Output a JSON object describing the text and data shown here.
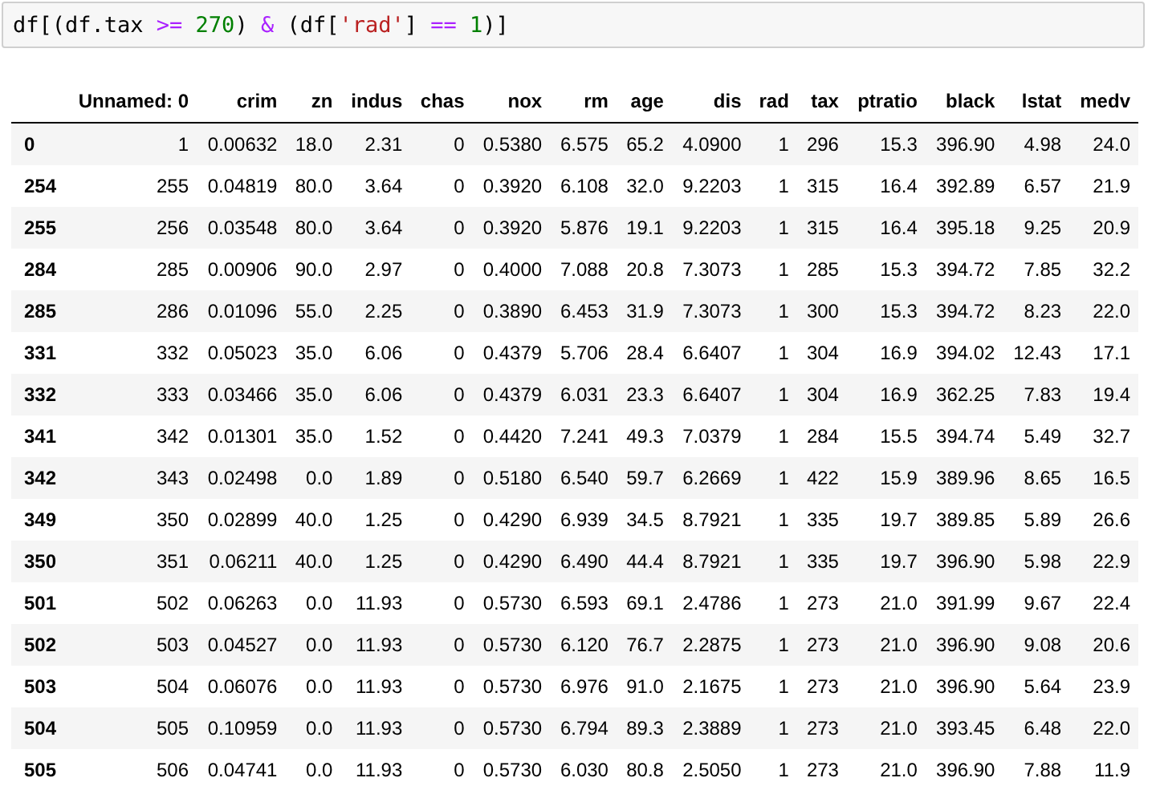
{
  "code_cell": {
    "tokens": [
      {
        "text": "df[(df.tax ",
        "kind": "plain"
      },
      {
        "text": ">=",
        "kind": "op"
      },
      {
        "text": " 270",
        "kind": "num"
      },
      {
        "text": ") ",
        "kind": "plain"
      },
      {
        "text": "&",
        "kind": "op"
      },
      {
        "text": " (df[",
        "kind": "plain"
      },
      {
        "text": "'rad'",
        "kind": "str"
      },
      {
        "text": "] ",
        "kind": "plain"
      },
      {
        "text": "==",
        "kind": "op"
      },
      {
        "text": " 1",
        "kind": "num"
      },
      {
        "text": ")]",
        "kind": "plain"
      }
    ]
  },
  "table": {
    "columns": [
      "Unnamed: 0",
      "crim",
      "zn",
      "indus",
      "chas",
      "nox",
      "rm",
      "age",
      "dis",
      "rad",
      "tax",
      "ptratio",
      "black",
      "lstat",
      "medv"
    ],
    "rows": [
      {
        "index": "0",
        "cells": [
          "1",
          "0.00632",
          "18.0",
          "2.31",
          "0",
          "0.5380",
          "6.575",
          "65.2",
          "4.0900",
          "1",
          "296",
          "15.3",
          "396.90",
          "4.98",
          "24.0"
        ]
      },
      {
        "index": "254",
        "cells": [
          "255",
          "0.04819",
          "80.0",
          "3.64",
          "0",
          "0.3920",
          "6.108",
          "32.0",
          "9.2203",
          "1",
          "315",
          "16.4",
          "392.89",
          "6.57",
          "21.9"
        ]
      },
      {
        "index": "255",
        "cells": [
          "256",
          "0.03548",
          "80.0",
          "3.64",
          "0",
          "0.3920",
          "5.876",
          "19.1",
          "9.2203",
          "1",
          "315",
          "16.4",
          "395.18",
          "9.25",
          "20.9"
        ]
      },
      {
        "index": "284",
        "cells": [
          "285",
          "0.00906",
          "90.0",
          "2.97",
          "0",
          "0.4000",
          "7.088",
          "20.8",
          "7.3073",
          "1",
          "285",
          "15.3",
          "394.72",
          "7.85",
          "32.2"
        ]
      },
      {
        "index": "285",
        "cells": [
          "286",
          "0.01096",
          "55.0",
          "2.25",
          "0",
          "0.3890",
          "6.453",
          "31.9",
          "7.3073",
          "1",
          "300",
          "15.3",
          "394.72",
          "8.23",
          "22.0"
        ]
      },
      {
        "index": "331",
        "cells": [
          "332",
          "0.05023",
          "35.0",
          "6.06",
          "0",
          "0.4379",
          "5.706",
          "28.4",
          "6.6407",
          "1",
          "304",
          "16.9",
          "394.02",
          "12.43",
          "17.1"
        ]
      },
      {
        "index": "332",
        "cells": [
          "333",
          "0.03466",
          "35.0",
          "6.06",
          "0",
          "0.4379",
          "6.031",
          "23.3",
          "6.6407",
          "1",
          "304",
          "16.9",
          "362.25",
          "7.83",
          "19.4"
        ]
      },
      {
        "index": "341",
        "cells": [
          "342",
          "0.01301",
          "35.0",
          "1.52",
          "0",
          "0.4420",
          "7.241",
          "49.3",
          "7.0379",
          "1",
          "284",
          "15.5",
          "394.74",
          "5.49",
          "32.7"
        ]
      },
      {
        "index": "342",
        "cells": [
          "343",
          "0.02498",
          "0.0",
          "1.89",
          "0",
          "0.5180",
          "6.540",
          "59.7",
          "6.2669",
          "1",
          "422",
          "15.9",
          "389.96",
          "8.65",
          "16.5"
        ]
      },
      {
        "index": "349",
        "cells": [
          "350",
          "0.02899",
          "40.0",
          "1.25",
          "0",
          "0.4290",
          "6.939",
          "34.5",
          "8.7921",
          "1",
          "335",
          "19.7",
          "389.85",
          "5.89",
          "26.6"
        ]
      },
      {
        "index": "350",
        "cells": [
          "351",
          "0.06211",
          "40.0",
          "1.25",
          "0",
          "0.4290",
          "6.490",
          "44.4",
          "8.7921",
          "1",
          "335",
          "19.7",
          "396.90",
          "5.98",
          "22.9"
        ]
      },
      {
        "index": "501",
        "cells": [
          "502",
          "0.06263",
          "0.0",
          "11.93",
          "0",
          "0.5730",
          "6.593",
          "69.1",
          "2.4786",
          "1",
          "273",
          "21.0",
          "391.99",
          "9.67",
          "22.4"
        ]
      },
      {
        "index": "502",
        "cells": [
          "503",
          "0.04527",
          "0.0",
          "11.93",
          "0",
          "0.5730",
          "6.120",
          "76.7",
          "2.2875",
          "1",
          "273",
          "21.0",
          "396.90",
          "9.08",
          "20.6"
        ]
      },
      {
        "index": "503",
        "cells": [
          "504",
          "0.06076",
          "0.0",
          "11.93",
          "0",
          "0.5730",
          "6.976",
          "91.0",
          "2.1675",
          "1",
          "273",
          "21.0",
          "396.90",
          "5.64",
          "23.9"
        ]
      },
      {
        "index": "504",
        "cells": [
          "505",
          "0.10959",
          "0.0",
          "11.93",
          "0",
          "0.5730",
          "6.794",
          "89.3",
          "2.3889",
          "1",
          "273",
          "21.0",
          "393.45",
          "6.48",
          "22.0"
        ]
      },
      {
        "index": "505",
        "cells": [
          "506",
          "0.04741",
          "0.0",
          "11.93",
          "0",
          "0.5730",
          "6.030",
          "80.8",
          "2.5050",
          "1",
          "273",
          "21.0",
          "396.90",
          "7.88",
          "11.9"
        ]
      }
    ]
  }
}
